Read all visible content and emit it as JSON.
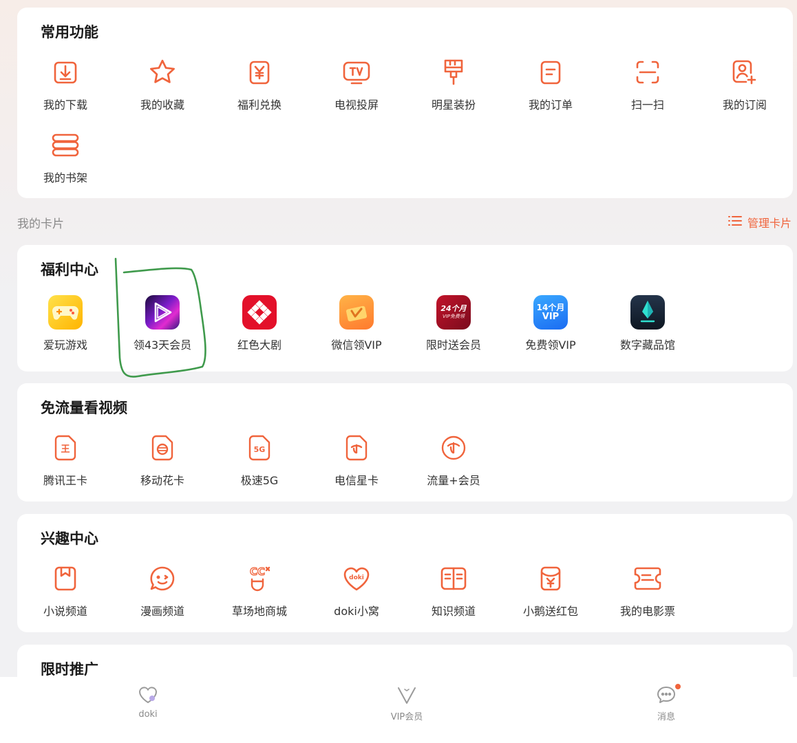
{
  "common": {
    "title": "常用功能",
    "items": [
      {
        "label": "我的下载",
        "icon": "download-icon"
      },
      {
        "label": "我的收藏",
        "icon": "star-icon"
      },
      {
        "label": "福利兑换",
        "icon": "yen-exchange-icon"
      },
      {
        "label": "电视投屏",
        "icon": "tv-cast-icon"
      },
      {
        "label": "明星装扮",
        "icon": "brush-icon"
      },
      {
        "label": "我的订单",
        "icon": "order-icon"
      },
      {
        "label": "扫一扫",
        "icon": "scan-icon"
      },
      {
        "label": "我的订阅",
        "icon": "subscribe-user-icon"
      },
      {
        "label": "我的书架",
        "icon": "bookshelf-icon"
      }
    ]
  },
  "cards_header": {
    "label": "我的卡片",
    "manage_label": "管理卡片"
  },
  "welfare": {
    "title": "福利中心",
    "items": [
      {
        "label": "爱玩游戏",
        "icon": "game-controller-icon"
      },
      {
        "label": "领43天会员",
        "icon": "video-play-app-icon"
      },
      {
        "label": "红色大剧",
        "icon": "red-drama-app-icon"
      },
      {
        "label": "微信领VIP",
        "icon": "wechat-vip-app-icon"
      },
      {
        "label": "限时送会员",
        "icon": "limited-vip-app-icon",
        "badge": "24个月\nVIP免费领"
      },
      {
        "label": "免费领VIP",
        "icon": "free-vip-app-icon",
        "badge": "14个月\nVIP"
      },
      {
        "label": "数字藏品馆",
        "icon": "digital-collection-app-icon"
      }
    ]
  },
  "traffic": {
    "title": "免流量看视频",
    "items": [
      {
        "label": "腾讯王卡",
        "icon": "wang-card-icon",
        "glyph": "王"
      },
      {
        "label": "移动花卡",
        "icon": "flower-card-icon"
      },
      {
        "label": "极速5G",
        "icon": "5g-card-icon",
        "glyph": "5G"
      },
      {
        "label": "电信星卡",
        "icon": "telecom-card-icon"
      },
      {
        "label": "流量+会员",
        "icon": "telecom-circle-icon"
      }
    ]
  },
  "interest": {
    "title": "兴趣中心",
    "items": [
      {
        "label": "小说频道",
        "icon": "novel-bookmark-icon"
      },
      {
        "label": "漫画频道",
        "icon": "comic-face-icon"
      },
      {
        "label": "草场地商城",
        "icon": "cc-mall-icon",
        "glyph": "CC"
      },
      {
        "label": "doki小窝",
        "icon": "doki-heart-icon",
        "glyph": "doki"
      },
      {
        "label": "知识频道",
        "icon": "book-open-icon"
      },
      {
        "label": "小鹅送红包",
        "icon": "red-envelope-icon"
      },
      {
        "label": "我的电影票",
        "icon": "movie-ticket-icon"
      }
    ]
  },
  "promo": {
    "title": "限时推广"
  },
  "tabbar": {
    "items": [
      {
        "label": "doki",
        "icon": "doki-tab-icon"
      },
      {
        "label": "VIP会员",
        "icon": "vip-tab-icon"
      },
      {
        "label": "消息",
        "icon": "message-tab-icon"
      }
    ]
  },
  "colors": {
    "accent": "#f0643c",
    "annotation": "#3f9a4c"
  }
}
